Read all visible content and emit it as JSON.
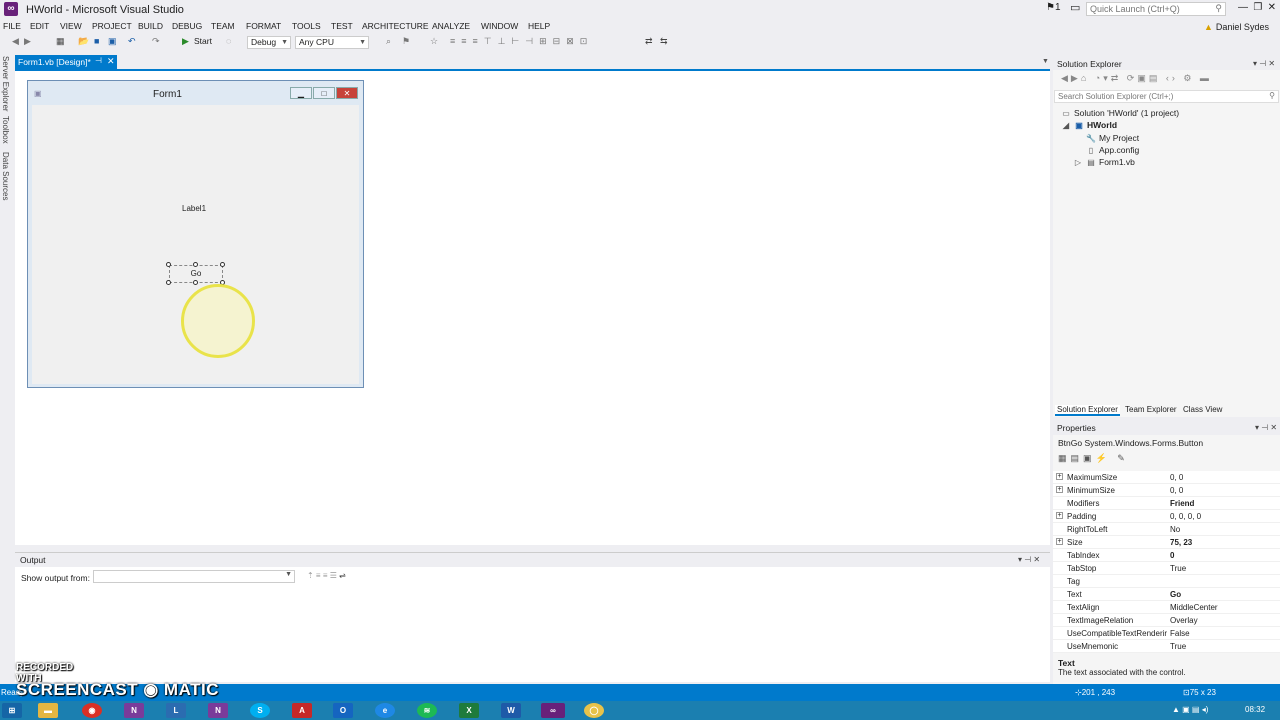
{
  "window": {
    "title": "HWorld - Microsoft Visual Studio",
    "notif_count": "1",
    "quick_launch_placeholder": "Quick Launch (Ctrl+Q)",
    "user": "Daniel Sydes",
    "controls": [
      "—",
      "❐",
      "✕"
    ]
  },
  "menu": [
    "FILE",
    "EDIT",
    "VIEW",
    "PROJECT",
    "BUILD",
    "DEBUG",
    "TEAM",
    "FORMAT",
    "TOOLS",
    "TEST",
    "ARCHITECTURE",
    "ANALYZE",
    "WINDOW",
    "HELP"
  ],
  "toolbar": {
    "start_label": "Start",
    "config": "Debug",
    "platform": "Any CPU"
  },
  "side_tabs": [
    "Server Explorer",
    "Toolbox",
    "Data Sources"
  ],
  "document_tab": {
    "label": "Form1.vb [Design]*"
  },
  "form": {
    "title": "Form1",
    "label": "Label1",
    "button": "Go"
  },
  "output": {
    "title": "Output",
    "show_from_label": "Show output from:",
    "show_from_value": ""
  },
  "solution_explorer": {
    "title": "Solution Explorer",
    "search_placeholder": "Search Solution Explorer (Ctrl+;)",
    "tree": {
      "solution": "Solution 'HWorld' (1 project)",
      "project": "HWorld",
      "my_project": "My Project",
      "app_config": "App.config",
      "form1": "Form1.vb"
    },
    "tabs": [
      "Solution Explorer",
      "Team Explorer",
      "Class View"
    ]
  },
  "properties": {
    "title": "Properties",
    "object_name": "BtnGo",
    "object_type": "System.Windows.Forms.Button",
    "rows": [
      {
        "name": "MaximumSize",
        "value": "0, 0",
        "expand": true,
        "bold": false
      },
      {
        "name": "MinimumSize",
        "value": "0, 0",
        "expand": true,
        "bold": false
      },
      {
        "name": "Modifiers",
        "value": "Friend",
        "expand": false,
        "bold": true
      },
      {
        "name": "Padding",
        "value": "0, 0, 0, 0",
        "expand": true,
        "bold": false
      },
      {
        "name": "RightToLeft",
        "value": "No",
        "expand": false,
        "bold": false
      },
      {
        "name": "Size",
        "value": "75, 23",
        "expand": true,
        "bold": true
      },
      {
        "name": "TabIndex",
        "value": "0",
        "expand": false,
        "bold": true
      },
      {
        "name": "TabStop",
        "value": "True",
        "expand": false,
        "bold": false
      },
      {
        "name": "Tag",
        "value": "",
        "expand": false,
        "bold": false
      },
      {
        "name": "Text",
        "value": "Go",
        "expand": false,
        "bold": true
      },
      {
        "name": "TextAlign",
        "value": "MiddleCenter",
        "expand": false,
        "bold": false
      },
      {
        "name": "TextImageRelation",
        "value": "Overlay",
        "expand": false,
        "bold": false
      },
      {
        "name": "UseCompatibleTextRenderir",
        "value": "False",
        "expand": false,
        "bold": false
      },
      {
        "name": "UseMnemonic",
        "value": "True",
        "expand": false,
        "bold": false
      }
    ],
    "desc_title": "Text",
    "desc_text": "The text associated with the control."
  },
  "status": {
    "ready": "Ready",
    "position": "201 , 243",
    "size": "75 x 23"
  },
  "watermark": {
    "line1": "RECORDED WITH",
    "line2": "SCREENCAST ◉ MATIC"
  },
  "taskbar": {
    "clock": "08:32"
  },
  "colors": {
    "accent": "#007acc",
    "vs_purple": "#68217a"
  }
}
